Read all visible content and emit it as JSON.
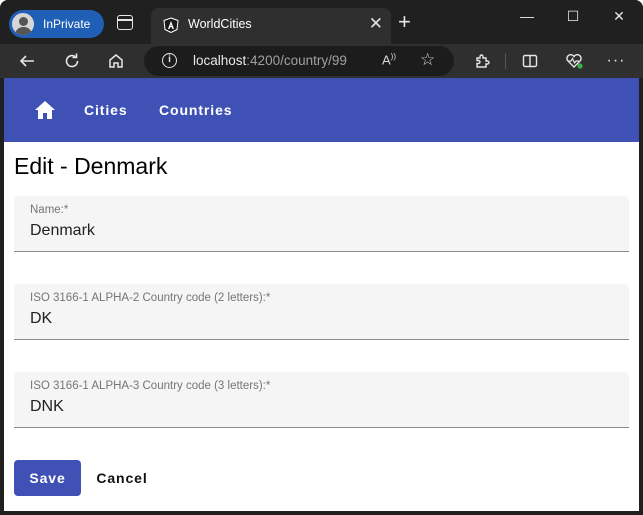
{
  "browser": {
    "profile_label": "InPrivate",
    "tab_title": "WorldCities",
    "url_host": "localhost",
    "url_rest": ":4200/country/99",
    "read_aloud": "A̅ "
  },
  "toolbar": {
    "cities": "Cities",
    "countries": "Countries"
  },
  "page": {
    "title": "Edit - Denmark"
  },
  "form": {
    "name_label": "Name:*",
    "name_value": "Denmark",
    "iso2_label": "ISO 3166-1 ALPHA-2 Country code (2 letters):*",
    "iso2_value": "DK",
    "iso3_label": "ISO 3166-1 ALPHA-3 Country code (3 letters):*",
    "iso3_value": "DNK"
  },
  "actions": {
    "save": "Save",
    "cancel": "Cancel"
  },
  "colors": {
    "accent": "#3f51b5",
    "inprivate": "#1f5fb5"
  }
}
